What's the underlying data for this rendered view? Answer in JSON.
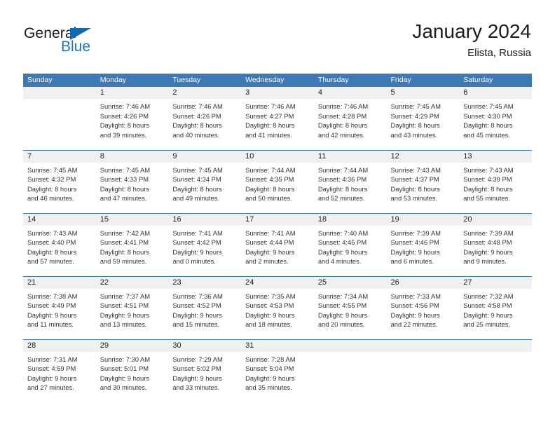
{
  "brand": {
    "name_part1": "General",
    "name_part2": "Blue",
    "logo_icon": "triangle-flag-icon"
  },
  "header": {
    "month_title": "January 2024",
    "location": "Elista, Russia"
  },
  "calendar": {
    "weekday_headers": [
      "Sunday",
      "Monday",
      "Tuesday",
      "Wednesday",
      "Thursday",
      "Friday",
      "Saturday"
    ],
    "accent_color": "#3c79b5",
    "daynum_band_color": "#f0f0f0",
    "weeks": [
      [
        {
          "blank": true,
          "day": "",
          "sunrise": "",
          "sunset": "",
          "daylight1": "",
          "daylight2": ""
        },
        {
          "day": "1",
          "sunrise": "Sunrise: 7:46 AM",
          "sunset": "Sunset: 4:26 PM",
          "daylight1": "Daylight: 8 hours",
          "daylight2": "and 39 minutes."
        },
        {
          "day": "2",
          "sunrise": "Sunrise: 7:46 AM",
          "sunset": "Sunset: 4:26 PM",
          "daylight1": "Daylight: 8 hours",
          "daylight2": "and 40 minutes."
        },
        {
          "day": "3",
          "sunrise": "Sunrise: 7:46 AM",
          "sunset": "Sunset: 4:27 PM",
          "daylight1": "Daylight: 8 hours",
          "daylight2": "and 41 minutes."
        },
        {
          "day": "4",
          "sunrise": "Sunrise: 7:46 AM",
          "sunset": "Sunset: 4:28 PM",
          "daylight1": "Daylight: 8 hours",
          "daylight2": "and 42 minutes."
        },
        {
          "day": "5",
          "sunrise": "Sunrise: 7:45 AM",
          "sunset": "Sunset: 4:29 PM",
          "daylight1": "Daylight: 8 hours",
          "daylight2": "and 43 minutes."
        },
        {
          "day": "6",
          "sunrise": "Sunrise: 7:45 AM",
          "sunset": "Sunset: 4:30 PM",
          "daylight1": "Daylight: 8 hours",
          "daylight2": "and 45 minutes."
        }
      ],
      [
        {
          "day": "7",
          "sunrise": "Sunrise: 7:45 AM",
          "sunset": "Sunset: 4:32 PM",
          "daylight1": "Daylight: 8 hours",
          "daylight2": "and 46 minutes."
        },
        {
          "day": "8",
          "sunrise": "Sunrise: 7:45 AM",
          "sunset": "Sunset: 4:33 PM",
          "daylight1": "Daylight: 8 hours",
          "daylight2": "and 47 minutes."
        },
        {
          "day": "9",
          "sunrise": "Sunrise: 7:45 AM",
          "sunset": "Sunset: 4:34 PM",
          "daylight1": "Daylight: 8 hours",
          "daylight2": "and 49 minutes."
        },
        {
          "day": "10",
          "sunrise": "Sunrise: 7:44 AM",
          "sunset": "Sunset: 4:35 PM",
          "daylight1": "Daylight: 8 hours",
          "daylight2": "and 50 minutes."
        },
        {
          "day": "11",
          "sunrise": "Sunrise: 7:44 AM",
          "sunset": "Sunset: 4:36 PM",
          "daylight1": "Daylight: 8 hours",
          "daylight2": "and 52 minutes."
        },
        {
          "day": "12",
          "sunrise": "Sunrise: 7:43 AM",
          "sunset": "Sunset: 4:37 PM",
          "daylight1": "Daylight: 8 hours",
          "daylight2": "and 53 minutes."
        },
        {
          "day": "13",
          "sunrise": "Sunrise: 7:43 AM",
          "sunset": "Sunset: 4:39 PM",
          "daylight1": "Daylight: 8 hours",
          "daylight2": "and 55 minutes."
        }
      ],
      [
        {
          "day": "14",
          "sunrise": "Sunrise: 7:43 AM",
          "sunset": "Sunset: 4:40 PM",
          "daylight1": "Daylight: 8 hours",
          "daylight2": "and 57 minutes."
        },
        {
          "day": "15",
          "sunrise": "Sunrise: 7:42 AM",
          "sunset": "Sunset: 4:41 PM",
          "daylight1": "Daylight: 8 hours",
          "daylight2": "and 59 minutes."
        },
        {
          "day": "16",
          "sunrise": "Sunrise: 7:41 AM",
          "sunset": "Sunset: 4:42 PM",
          "daylight1": "Daylight: 9 hours",
          "daylight2": "and 0 minutes."
        },
        {
          "day": "17",
          "sunrise": "Sunrise: 7:41 AM",
          "sunset": "Sunset: 4:44 PM",
          "daylight1": "Daylight: 9 hours",
          "daylight2": "and 2 minutes."
        },
        {
          "day": "18",
          "sunrise": "Sunrise: 7:40 AM",
          "sunset": "Sunset: 4:45 PM",
          "daylight1": "Daylight: 9 hours",
          "daylight2": "and 4 minutes."
        },
        {
          "day": "19",
          "sunrise": "Sunrise: 7:39 AM",
          "sunset": "Sunset: 4:46 PM",
          "daylight1": "Daylight: 9 hours",
          "daylight2": "and 6 minutes."
        },
        {
          "day": "20",
          "sunrise": "Sunrise: 7:39 AM",
          "sunset": "Sunset: 4:48 PM",
          "daylight1": "Daylight: 9 hours",
          "daylight2": "and 9 minutes."
        }
      ],
      [
        {
          "day": "21",
          "sunrise": "Sunrise: 7:38 AM",
          "sunset": "Sunset: 4:49 PM",
          "daylight1": "Daylight: 9 hours",
          "daylight2": "and 11 minutes."
        },
        {
          "day": "22",
          "sunrise": "Sunrise: 7:37 AM",
          "sunset": "Sunset: 4:51 PM",
          "daylight1": "Daylight: 9 hours",
          "daylight2": "and 13 minutes."
        },
        {
          "day": "23",
          "sunrise": "Sunrise: 7:36 AM",
          "sunset": "Sunset: 4:52 PM",
          "daylight1": "Daylight: 9 hours",
          "daylight2": "and 15 minutes."
        },
        {
          "day": "24",
          "sunrise": "Sunrise: 7:35 AM",
          "sunset": "Sunset: 4:53 PM",
          "daylight1": "Daylight: 9 hours",
          "daylight2": "and 18 minutes."
        },
        {
          "day": "25",
          "sunrise": "Sunrise: 7:34 AM",
          "sunset": "Sunset: 4:55 PM",
          "daylight1": "Daylight: 9 hours",
          "daylight2": "and 20 minutes."
        },
        {
          "day": "26",
          "sunrise": "Sunrise: 7:33 AM",
          "sunset": "Sunset: 4:56 PM",
          "daylight1": "Daylight: 9 hours",
          "daylight2": "and 22 minutes."
        },
        {
          "day": "27",
          "sunrise": "Sunrise: 7:32 AM",
          "sunset": "Sunset: 4:58 PM",
          "daylight1": "Daylight: 9 hours",
          "daylight2": "and 25 minutes."
        }
      ],
      [
        {
          "day": "28",
          "sunrise": "Sunrise: 7:31 AM",
          "sunset": "Sunset: 4:59 PM",
          "daylight1": "Daylight: 9 hours",
          "daylight2": "and 27 minutes."
        },
        {
          "day": "29",
          "sunrise": "Sunrise: 7:30 AM",
          "sunset": "Sunset: 5:01 PM",
          "daylight1": "Daylight: 9 hours",
          "daylight2": "and 30 minutes."
        },
        {
          "day": "30",
          "sunrise": "Sunrise: 7:29 AM",
          "sunset": "Sunset: 5:02 PM",
          "daylight1": "Daylight: 9 hours",
          "daylight2": "and 33 minutes."
        },
        {
          "day": "31",
          "sunrise": "Sunrise: 7:28 AM",
          "sunset": "Sunset: 5:04 PM",
          "daylight1": "Daylight: 9 hours",
          "daylight2": "and 35 minutes."
        },
        {
          "blank": true,
          "day": "",
          "sunrise": "",
          "sunset": "",
          "daylight1": "",
          "daylight2": ""
        },
        {
          "blank": true,
          "day": "",
          "sunrise": "",
          "sunset": "",
          "daylight1": "",
          "daylight2": ""
        },
        {
          "blank": true,
          "day": "",
          "sunrise": "",
          "sunset": "",
          "daylight1": "",
          "daylight2": ""
        }
      ]
    ]
  }
}
